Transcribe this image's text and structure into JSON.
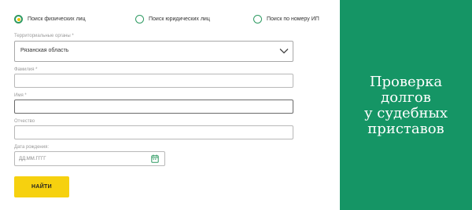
{
  "search_types": [
    {
      "label": "Поиск физических лиц",
      "selected": true
    },
    {
      "label": "Поиск юридических лиц",
      "selected": false
    },
    {
      "label": "Поиск по номеру ИП",
      "selected": false
    }
  ],
  "form": {
    "region": {
      "label": "Территориальные органы *",
      "value": "Рязанская область",
      "icon": "chevron-down-icon"
    },
    "surname": {
      "label": "Фамилия *",
      "value": ""
    },
    "name": {
      "label": "Имя *",
      "value": ""
    },
    "patronymic": {
      "label": "Отчество",
      "value": ""
    },
    "birth_date": {
      "label": "Дата рождения:",
      "placeholder": "ДД.ММ.ГГГГ",
      "icon": "calendar-icon"
    }
  },
  "submit_label": "НАЙТИ",
  "side_panel": {
    "title_lines": [
      "Проверка",
      "долгов",
      "у судебных",
      "приставов"
    ]
  },
  "colors": {
    "accent_green": "#159565",
    "radio_green": "#2e9a62",
    "button_yellow": "#f6d10f"
  }
}
